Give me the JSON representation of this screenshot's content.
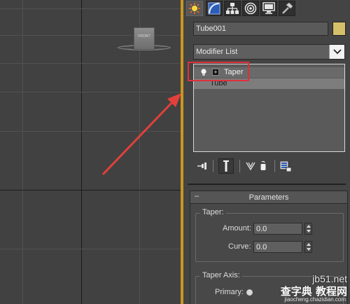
{
  "viewport": {
    "viewcube_face": "FRONT"
  },
  "command_panel": {
    "tabs": [
      {
        "icon": "create-icon",
        "active": true
      },
      {
        "icon": "modify-icon",
        "active": false
      },
      {
        "icon": "hierarchy-icon",
        "active": false
      },
      {
        "icon": "motion-icon",
        "active": false
      },
      {
        "icon": "display-icon",
        "active": false
      },
      {
        "icon": "utilities-icon",
        "active": false
      }
    ],
    "object_name": "Tube001",
    "object_color": "#d6bf6a",
    "modifier_list_label": "Modifier List",
    "modifier_stack": {
      "items": [
        {
          "label": "Taper",
          "expand": "+",
          "selected": true
        },
        {
          "label": "Tube",
          "selected": false
        }
      ],
      "highlight_color": "#e0303a"
    },
    "parameters": {
      "title": "Parameters",
      "collapse_glyph": "–",
      "taper_group": {
        "title": "Taper:",
        "amount_label": "Amount:",
        "amount_value": "0.0",
        "curve_label": "Curve:",
        "curve_value": "0.0"
      },
      "taper_axis_group": {
        "title": "Taper Axis:",
        "primary_label": "Primary:"
      }
    }
  },
  "annotation": {
    "arrow_color": "#e3403a"
  },
  "watermark": {
    "line1": "jb51.net",
    "line2": "查字典 教程网",
    "line3": "jiaocheng.chazidian.com"
  }
}
